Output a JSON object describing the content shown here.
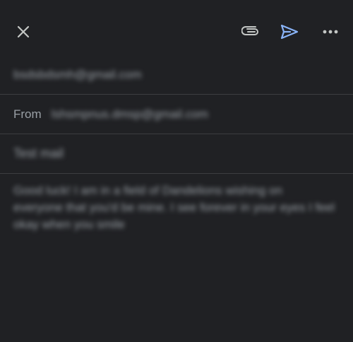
{
  "toolbar": {
    "close": "close-icon",
    "attach": "paperclip-icon",
    "send": "send-icon",
    "more": "more-horizontal-icon",
    "send_color": "#8ab4f8"
  },
  "compose": {
    "to_value": "bsdsbdsmh@gmail.com",
    "from_label": "From",
    "from_value": "lshsmpnus.dmsp@gmail.com",
    "subject_value": "Test mail",
    "body_value": "Good luck! I am in a field of Dandelions wishing on everyone that you'd be mine. I see forever in your eyes I feel okay when you smile"
  }
}
